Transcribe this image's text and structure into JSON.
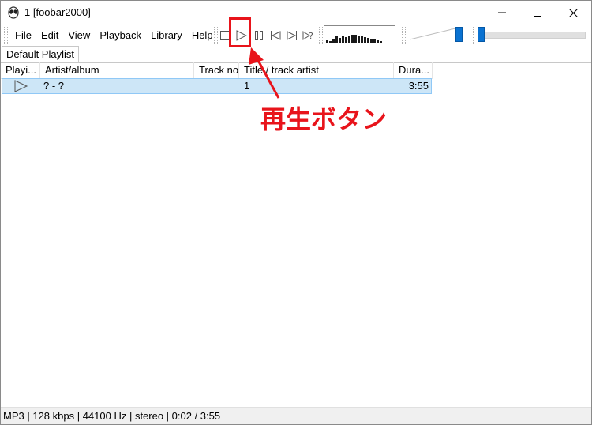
{
  "window": {
    "title": "1  [foobar2000]"
  },
  "menu": [
    "File",
    "Edit",
    "View",
    "Playback",
    "Library",
    "Help"
  ],
  "toolbar": {
    "buttons": [
      "stop-icon",
      "play-icon",
      "pause-icon",
      "previous-icon",
      "next-icon",
      "random-icon"
    ]
  },
  "volume": {
    "level": 0.9
  },
  "seekbar": {
    "position": 0.01
  },
  "tabs": {
    "active": "Default Playlist"
  },
  "playlist": {
    "columns": [
      "Playi...",
      "Artist/album",
      "Track no",
      "Title / track artist",
      "Dura..."
    ],
    "rows": [
      {
        "playing_icon": "play-indicator-icon",
        "artist_album": "? - ?",
        "track_no": "1",
        "title": "",
        "duration": "3:55"
      }
    ]
  },
  "statusbar": {
    "text": "MP3 | 128 kbps | 44100 Hz | stereo | 0:02 / 3:55"
  },
  "annotation": {
    "label": "再生ボタン",
    "color": "#e8141b"
  }
}
